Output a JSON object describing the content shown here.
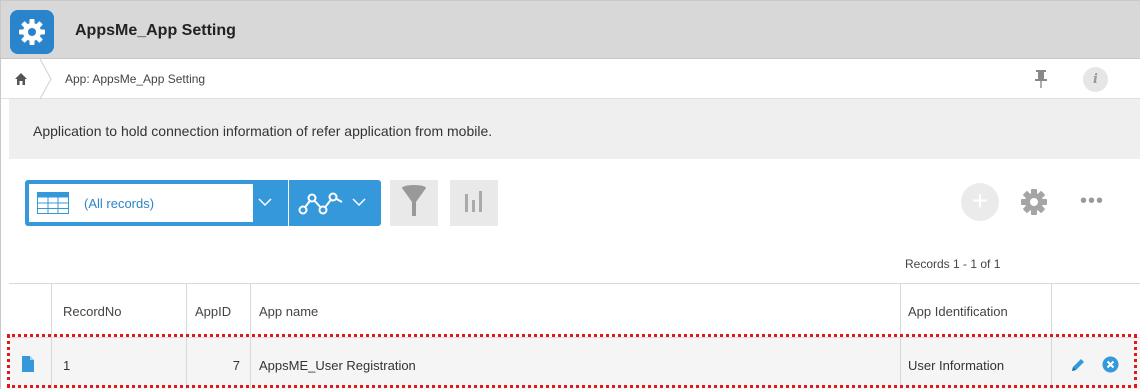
{
  "header": {
    "app_icon": "gear-icon",
    "title": "AppsMe_App Setting"
  },
  "breadcrumb": {
    "home_icon": "home-icon",
    "text": "App: AppsMe_App Setting",
    "pin_icon": "pin-icon",
    "info_icon": "info-icon",
    "info_glyph": "i"
  },
  "description": "Application to hold connection information of refer application from mobile.",
  "toolbar": {
    "view_label": "(All records)",
    "add_glyph": "+",
    "more_glyph": "•••"
  },
  "records_count": "Records 1 - 1 of 1",
  "table": {
    "columns": [
      "RecordNo",
      "AppID",
      "App name",
      "App Identification"
    ],
    "rows": [
      {
        "record_no": "1",
        "app_id": "7",
        "app_name": "AppsME_User Registration",
        "app_identification": "User Information"
      }
    ]
  },
  "colors": {
    "accent": "#3498db",
    "header_bg": "#d8d8d8",
    "selection": "#e01919"
  }
}
